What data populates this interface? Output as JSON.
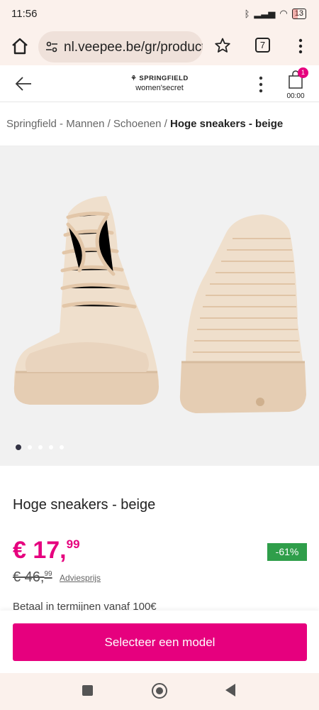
{
  "status": {
    "time": "11:56",
    "battery": "13"
  },
  "browser": {
    "url": "nl.veepee.be/gr/product",
    "tab_count": "7"
  },
  "site": {
    "brand_line1": "⚘ SPRINGFIELD",
    "brand_line2": "women'secret",
    "cart_count": "1",
    "cart_timer": "00:00"
  },
  "breadcrumb": {
    "path": "Springfield - Mannen / Schoenen / ",
    "current": "Hoge sneakers - beige"
  },
  "gallery": {
    "dots": 5,
    "active_dot": 0
  },
  "product": {
    "title": "Hoge sneakers - beige",
    "price_main": "€ 17,",
    "price_cents": "99",
    "old_price_main": "€ 46,",
    "old_price_cents": "99",
    "advies_label": "Adviesprijs",
    "discount": "-61%",
    "installments": "Betaal in termijnen vanaf 100€"
  },
  "cta": {
    "label": "Selecteer een model"
  },
  "colors": {
    "accent": "#e6007e",
    "discount": "#2f9e4a",
    "shoe": "#efdfcc"
  }
}
